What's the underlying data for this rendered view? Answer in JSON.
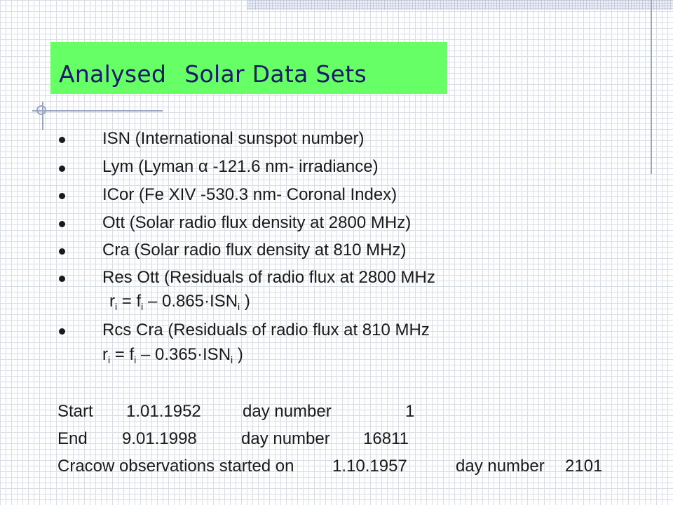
{
  "title": {
    "word1": "Analysed",
    "word2": "Solar Data Sets"
  },
  "bullets": [
    "ISN    (International sunspot number)",
    "Lym (Lyman α -121.6 nm- irradiance)",
    "ICor  (Fe XIV -530.3 nm- Coronal Index)",
    "Ott    (Solar radio flux density at 2800  MHz)",
    "Cra  (Solar radio flux density at 810  MHz)",
    "Res  Ott  (Residuals of radio flux at 2800 MHz",
    "Rcs Cra  (Residuals of radio flux at 810 MHz"
  ],
  "formula1": {
    "r": "r",
    "i1": "i",
    "eq": " = f",
    "i2": "i",
    "mid": " – 0.865·ISN",
    "i3": "i",
    "end": " )"
  },
  "formula2": {
    "r": "r",
    "i1": "i",
    "eq": " = f",
    "i2": "i",
    "mid": " – 0.365·ISN",
    "i3": "i",
    "end": " )"
  },
  "footer": {
    "start_label": "Start",
    "start_date": "1.01.1952",
    "start_dn_label": "day number",
    "start_dn": "1",
    "end_label": "End",
    "end_date": "9.01.1998",
    "end_dn_label": "day number",
    "end_dn": "16811",
    "cracow_label": "Cracow observations started on",
    "cracow_date": "1.10.1957",
    "cracow_dn_label": "day number",
    "cracow_dn": "2101"
  }
}
